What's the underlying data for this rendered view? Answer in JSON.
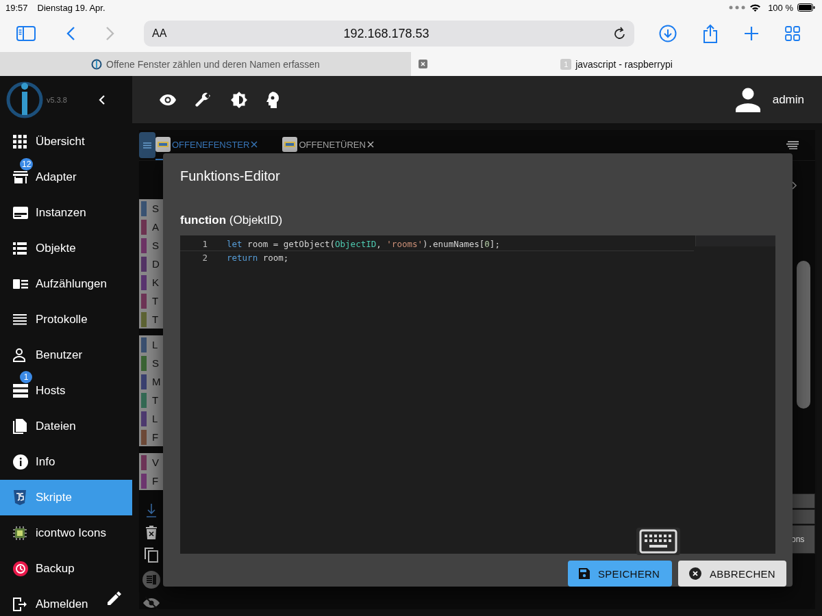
{
  "status_bar": {
    "time": "19:57",
    "date": "Dienstag 19. Apr.",
    "battery": "100 %"
  },
  "browser": {
    "text_size": "AA",
    "address": "192.168.178.53",
    "forward_disabled": true
  },
  "browser_tabs": [
    {
      "title": "Offene Fenster zählen und deren Namen erfassen",
      "selected": false
    },
    {
      "title": "javascript - raspberrypi",
      "badge": "1",
      "selected": true
    }
  ],
  "app": {
    "version": "v5.3.8",
    "user": "admin",
    "sidebar": [
      {
        "label": "Übersicht",
        "kind": "grid",
        "selected": false
      },
      {
        "label": "Adapter",
        "kind": "store",
        "badge": "12",
        "selected": false
      },
      {
        "label": "Instanzen",
        "kind": "card",
        "selected": false
      },
      {
        "label": "Objekte",
        "kind": "list",
        "selected": false
      },
      {
        "label": "Aufzählungen",
        "kind": "enum",
        "selected": false
      },
      {
        "label": "Protokolle",
        "kind": "lines",
        "selected": false
      },
      {
        "label": "Benutzer",
        "kind": "person",
        "selected": false
      },
      {
        "label": "Hosts",
        "kind": "server",
        "badge": "1",
        "selected": false
      },
      {
        "label": "Dateien",
        "kind": "files",
        "selected": false
      },
      {
        "label": "Info",
        "kind": "info",
        "selected": false
      },
      {
        "label": "Skripte",
        "kind": "js",
        "selected": true
      },
      {
        "label": "icontwo Icons",
        "kind": "chip",
        "selected": false
      },
      {
        "label": "Backup",
        "kind": "backup",
        "selected": false
      },
      {
        "label": "Abmelden",
        "kind": "logout",
        "selected": false
      }
    ],
    "script_tabs": [
      {
        "label": "OFFENEFENSTER",
        "selected": true
      },
      {
        "label": "OFFENETÜREN",
        "selected": false
      }
    ],
    "script_list": [
      {
        "letter": "S",
        "color": "#3a5474"
      },
      {
        "letter": "A",
        "color": "#6e3452"
      },
      {
        "letter": "S",
        "color": "#6e3466"
      },
      {
        "letter": "D",
        "color": "#543466"
      },
      {
        "letter": "K",
        "color": "#5a3470"
      },
      {
        "letter": "T",
        "color": "#6e3456"
      },
      {
        "letter": "T",
        "color": "#5e6434"
      },
      {
        "letter": "L",
        "color": "#3a5070"
      },
      {
        "letter": "S",
        "color": "#3a6434"
      },
      {
        "letter": "M",
        "color": "#3a4070"
      },
      {
        "letter": "T",
        "color": "#346a54"
      },
      {
        "letter": "L",
        "color": "#4e3a70"
      },
      {
        "letter": "F",
        "color": "#6e4a38"
      },
      {
        "letter": "V",
        "color": "#6e3458"
      },
      {
        "letter": "F",
        "color": "#6e3670"
      }
    ],
    "side_cell": "ons"
  },
  "dialog": {
    "title": "Funktions-Editor",
    "signature": {
      "keyword": "function",
      "args": "(ObjektID)"
    },
    "code": [
      {
        "number": "1",
        "tokens": [
          {
            "kind": "keyword",
            "text": "let"
          },
          {
            "kind": "plain",
            "text": " room = getObject("
          },
          {
            "kind": "ident",
            "text": "ObjectID"
          },
          {
            "kind": "plain",
            "text": ", "
          },
          {
            "kind": "string",
            "text": "'rooms'"
          },
          {
            "kind": "plain",
            "text": ").enumNames["
          },
          {
            "kind": "number",
            "text": "0"
          },
          {
            "kind": "plain",
            "text": "];"
          }
        ]
      },
      {
        "number": "2",
        "tokens": [
          {
            "kind": "keyword",
            "text": "return"
          },
          {
            "kind": "plain",
            "text": " room;"
          }
        ]
      }
    ],
    "buttons": [
      {
        "label": "SPEICHERN",
        "kind": "primary"
      },
      {
        "label": "ABBRECHEN",
        "kind": "secondary"
      }
    ]
  }
}
